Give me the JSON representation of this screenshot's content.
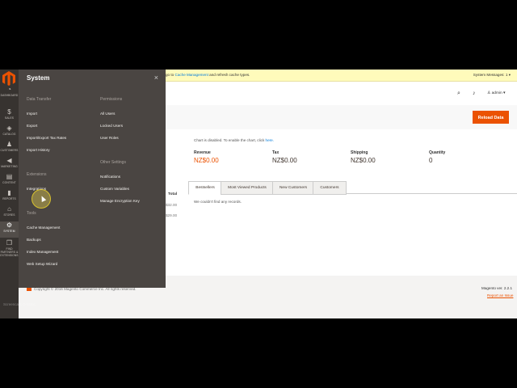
{
  "nav": {
    "items": [
      {
        "label": "DASHBOARD",
        "icon": "dashboard-icon",
        "glyph": "◔"
      },
      {
        "label": "SALES",
        "icon": "dollar-icon",
        "glyph": "$"
      },
      {
        "label": "CATALOG",
        "icon": "cube-icon",
        "glyph": "◈"
      },
      {
        "label": "CUSTOMERS",
        "icon": "person-icon",
        "glyph": "♟"
      },
      {
        "label": "MARKETING",
        "icon": "megaphone-icon",
        "glyph": "◀"
      },
      {
        "label": "CONTENT",
        "icon": "layout-icon",
        "glyph": "▤"
      },
      {
        "label": "REPORTS",
        "icon": "bar-chart-icon",
        "glyph": "▮"
      },
      {
        "label": "STORES",
        "icon": "store-icon",
        "glyph": "⌂"
      },
      {
        "label": "SYSTEM",
        "icon": "gear-icon",
        "glyph": "⚙"
      },
      {
        "label": "FIND PARTNERS & EXTENSIONS",
        "icon": "box-icon",
        "glyph": "❒"
      }
    ]
  },
  "flyout": {
    "title": "System",
    "close": "×",
    "data_transfer": {
      "heading": "Data Transfer",
      "links": [
        "Import",
        "Export",
        "Import/Export Tax Rates",
        "Import History"
      ]
    },
    "extensions": {
      "heading": "Extensions",
      "links": [
        "Integrations"
      ]
    },
    "tools": {
      "heading": "Tools",
      "links": [
        "Cache Management",
        "Backups",
        "Index Management",
        "Web Setup Wizard"
      ]
    },
    "permissions": {
      "heading": "Permissions",
      "links": [
        "All Users",
        "Locked Users",
        "User Roles"
      ]
    },
    "other": {
      "heading": "Other Settings",
      "links": [
        "Notifications",
        "Custom Variables",
        "Manage Encryption Key"
      ]
    }
  },
  "header": {
    "message_prefix": "go to ",
    "message_link": "Cache Management",
    "message_suffix": " and refresh cache types.",
    "system_messages": "System Messages: 1 ▾",
    "user": "admin ▾"
  },
  "reload_label": "Reload Data",
  "chart_notice_prefix": "Chart is disabled. To enable the chart, click ",
  "chart_notice_link": "here.",
  "stats": [
    {
      "label": "Revenue",
      "value": "NZ$0.00",
      "color": "#eb5202"
    },
    {
      "label": "Tax",
      "value": "NZ$0.00",
      "color": "#41362f"
    },
    {
      "label": "Shipping",
      "value": "NZ$0.00",
      "color": "#41362f"
    },
    {
      "label": "Quantity",
      "value": "0",
      "color": "#41362f"
    }
  ],
  "tabs": [
    "Bestsellers",
    "Most Viewed Products",
    "New Customers",
    "Customers"
  ],
  "no_records": "We couldn't find any records.",
  "left_col": {
    "header": "Total",
    "values": [
      "$32.00",
      "$29.00"
    ]
  },
  "footer": {
    "copyright": "Copyright © 2016 Magento Commerce Inc. All rights reserved.",
    "version": "Magento ver. 2.2.1",
    "report": "Report an Issue"
  },
  "watermark": "Screencast-O-Matic"
}
